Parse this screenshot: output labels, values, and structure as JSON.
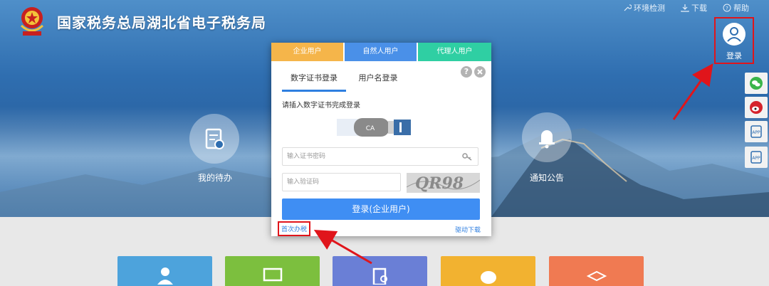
{
  "header": {
    "site_title": "国家税务总局湖北省电子税务局",
    "links": [
      {
        "label": "环境检测",
        "icon": "wrench-icon"
      },
      {
        "label": "下载",
        "icon": "download-icon"
      },
      {
        "label": "帮助",
        "icon": "help-circle-icon"
      }
    ],
    "login_label": "登录"
  },
  "features": {
    "todo_label": "我的待办",
    "notice_label": "通知公告"
  },
  "side_buttons": [
    "wechat-icon",
    "weibo-icon",
    "app-icon",
    "app-icon"
  ],
  "modal": {
    "tabs": [
      {
        "label": "企业用户",
        "color": "#f5b54a"
      },
      {
        "label": "自然人用户",
        "color": "#4a90e8"
      },
      {
        "label": "代理人用户",
        "color": "#2fcfa3"
      }
    ],
    "subtabs": [
      "数字证书登录",
      "用户名登录"
    ],
    "hint": "请插入数字证书完成登录",
    "usb_label": "CA",
    "cert_password_placeholder": "输入证书密码",
    "captcha_placeholder": "输入验证码",
    "captcha_text": "QR98",
    "submit_label": "登录(企业用户)",
    "first_time_label": "首次办税",
    "driver_download_label": "驱动下载"
  },
  "tiles": [
    {
      "color": "#4da3dc",
      "icon": "person-icon"
    },
    {
      "color": "#7cbf3e",
      "icon": "monitor-icon"
    },
    {
      "color": "#6a7fd6",
      "icon": "document-search-icon"
    },
    {
      "color": "#f2b230",
      "icon": "chat-icon"
    },
    {
      "color": "#f07a52",
      "icon": "graduate-icon"
    }
  ],
  "colors": {
    "accent": "#3f8ef3",
    "highlight": "#e0151b"
  }
}
